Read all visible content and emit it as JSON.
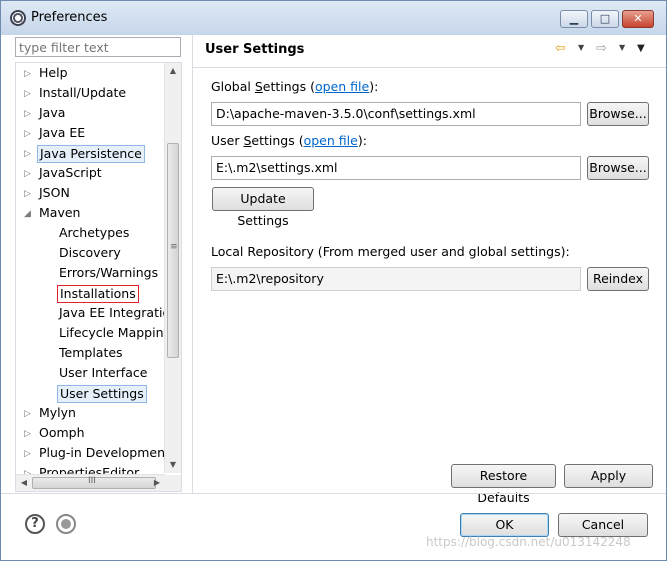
{
  "window": {
    "title": "Preferences"
  },
  "filter": {
    "placeholder": "type filter text"
  },
  "tree": {
    "items": [
      {
        "label": "Help",
        "arrow": "▷"
      },
      {
        "label": "Install/Update",
        "arrow": "▷"
      },
      {
        "label": "Java",
        "arrow": "▷"
      },
      {
        "label": "Java EE",
        "arrow": "▷"
      },
      {
        "label": "Java Persistence",
        "arrow": "▷"
      },
      {
        "label": "JavaScript",
        "arrow": "▷"
      },
      {
        "label": "JSON",
        "arrow": "▷"
      },
      {
        "label": "Maven",
        "arrow": "◢"
      },
      {
        "label": "Archetypes"
      },
      {
        "label": "Discovery"
      },
      {
        "label": "Errors/Warnings"
      },
      {
        "label": "Installations"
      },
      {
        "label": "Java EE Integration"
      },
      {
        "label": "Lifecycle Mapping"
      },
      {
        "label": "Templates"
      },
      {
        "label": "User Interface"
      },
      {
        "label": "User Settings"
      },
      {
        "label": "Mylyn",
        "arrow": "▷"
      },
      {
        "label": "Oomph",
        "arrow": "▷"
      },
      {
        "label": "Plug-in Development",
        "arrow": "▷"
      },
      {
        "label": "PropertiesEditor",
        "arrow": "▷"
      }
    ]
  },
  "page": {
    "title": "User Settings",
    "global_label_pre": "Global ",
    "global_label_s": "S",
    "global_label_post": "ettings (",
    "open_file": "open file",
    "label_close": "):",
    "global_path": "D:\\apache-maven-3.5.0\\conf\\settings.xml",
    "browse": "Browse...",
    "user_label_pre": "User ",
    "user_label_s": "S",
    "user_label_post": "ettings (",
    "user_path": "E:\\.m2\\settings.xml",
    "update_settings": "Update Settings",
    "local_repo_label": "Local Repository (From merged user and global settings):",
    "local_repo_path": "E:\\.m2\\repository",
    "reindex": "Reindex"
  },
  "footer": {
    "restore_defaults": "Restore Defaults",
    "apply": "Apply",
    "ok": "OK",
    "cancel": "Cancel",
    "watermark": "https://blog.csdn.net/u013142248"
  }
}
